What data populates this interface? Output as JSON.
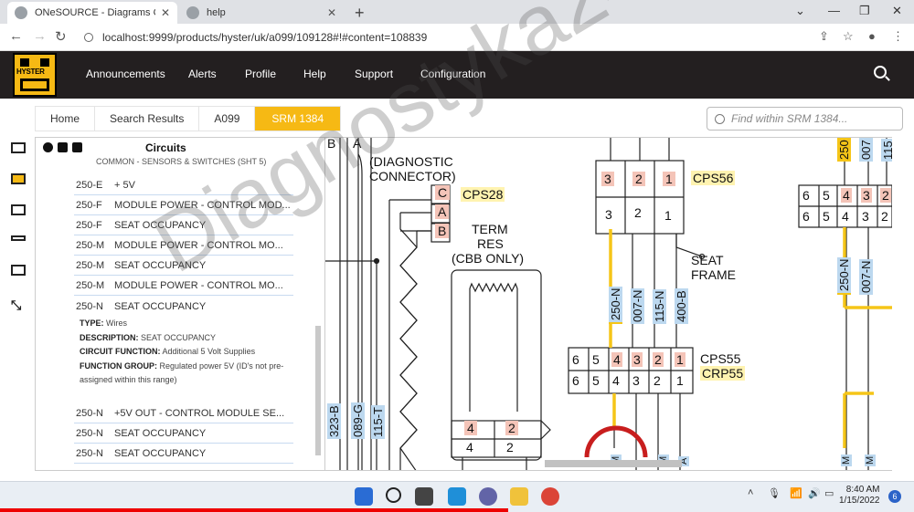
{
  "browser": {
    "tabs": [
      {
        "title": "ONeSOURCE - Diagrams Catalog",
        "active": true
      },
      {
        "title": "help",
        "active": false
      }
    ],
    "new_tab_label": "+",
    "url": "localhost:9999/products/hyster/uk/a099/109128#!#content=108839"
  },
  "header": {
    "logo_text": "HYSTER",
    "menu": [
      "Announcements",
      "Alerts",
      "Profile",
      "Help",
      "Support",
      "Configuration"
    ]
  },
  "breadcrumb": [
    "Home",
    "Search Results",
    "A099",
    "SRM 1384"
  ],
  "find": {
    "placeholder": "Find within SRM 1384..."
  },
  "circuits": {
    "title": "Circuits",
    "subtitle": "COMMON - SENSORS & SWITCHES (SHT 5)",
    "rows_top": [
      {
        "code": "250-E",
        "desc": "+ 5V"
      },
      {
        "code": "250-F",
        "desc": "MODULE POWER - CONTROL MOD..."
      },
      {
        "code": "250-F",
        "desc": "SEAT OCCUPANCY"
      },
      {
        "code": "250-M",
        "desc": "MODULE POWER - CONTROL MO..."
      },
      {
        "code": "250-M",
        "desc": "SEAT OCCUPANCY"
      },
      {
        "code": "250-M",
        "desc": "MODULE POWER - CONTROL MO..."
      },
      {
        "code": "250-N",
        "desc": "SEAT OCCUPANCY"
      }
    ],
    "detail": {
      "type_label": "TYPE:",
      "type": "Wires",
      "desc_label": "DESCRIPTION:",
      "desc": "SEAT OCCUPANCY",
      "func_label": "CIRCUIT FUNCTION:",
      "func": "Additional 5 Volt Supplies",
      "group_label": "FUNCTION GROUP:",
      "group": "Regulated power 5V (ID's not pre-assigned within this range)"
    },
    "rows_bottom": [
      {
        "code": "250-N",
        "desc": "+5V OUT - CONTROL MODULE SE..."
      },
      {
        "code": "250-N",
        "desc": "SEAT OCCUPANCY"
      },
      {
        "code": "250-N",
        "desc": "SEAT OCCUPANCY"
      }
    ]
  },
  "diagram": {
    "col_labels": [
      "B",
      "A"
    ],
    "diag_connector": [
      "(DIAGNOSTIC",
      "CONNECTOR)"
    ],
    "pins_cab": [
      "C",
      "A",
      "B"
    ],
    "cps28": "CPS28",
    "term_res": [
      "TERM",
      "RES",
      "(CBB ONLY)"
    ],
    "cps56": "CPS56",
    "cps56_top": [
      "3",
      "2",
      "1"
    ],
    "cps56_bottom": [
      "3",
      "2",
      "1"
    ],
    "seat_frame": [
      "SEAT",
      "FRAME"
    ],
    "wires_mid": [
      "250-N",
      "007-N",
      "115-N",
      "400-B"
    ],
    "cps55_top": [
      "6",
      "5",
      "4",
      "3",
      "2",
      "1"
    ],
    "cps55_bottom": [
      "6",
      "5",
      "4",
      "3",
      "2",
      "1"
    ],
    "cps55": "CPS55",
    "crp55": "CRP55",
    "wires_left": [
      "323-B",
      "089-G",
      "115-T"
    ],
    "res_pins_top": [
      "4",
      "2"
    ],
    "res_pins_bottom": [
      "4",
      "2"
    ],
    "right_top": [
      "6",
      "5",
      "4",
      "3",
      "2"
    ],
    "right_bottom": [
      "6",
      "5",
      "4",
      "3",
      "2"
    ],
    "right_wires_top": [
      "250",
      "007",
      "115"
    ],
    "right_wires_mid": [
      "250-N",
      "007-N"
    ],
    "bottom_marks": [
      "M",
      "M",
      "A",
      "M",
      "M"
    ]
  },
  "watermark": "Diagnostyka24",
  "taskbar": {
    "time": "8:40 AM",
    "date": "1/15/2022",
    "notifications": "6"
  },
  "colors": {
    "brand": "#f6b914",
    "header_bg": "#231f20",
    "wire_yellow": "#f5c518",
    "label_blue": "#bcd8ef",
    "pin_pink": "#f4c4b8"
  }
}
